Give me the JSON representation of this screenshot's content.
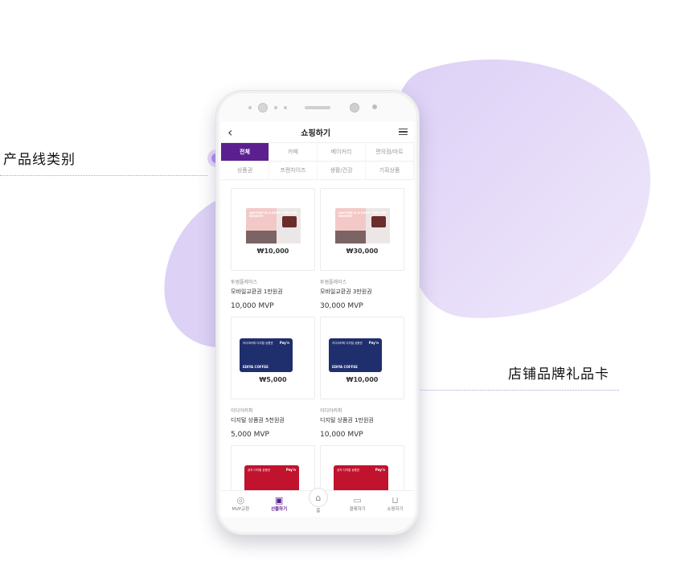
{
  "callouts": {
    "left": "产品线类别",
    "right": "店铺品牌礼品卡"
  },
  "colors": {
    "accent": "#5b1f8f",
    "blob": "#e2d8f7"
  },
  "app": {
    "back_icon": "chevron-left-icon",
    "title": "쇼핑하기",
    "menu_icon": "hamburger-icon"
  },
  "tabs_row1": [
    {
      "label": "전체",
      "active": true
    },
    {
      "label": "카페"
    },
    {
      "label": "베이커리"
    },
    {
      "label": "편의점/마트"
    }
  ],
  "tabs_row2": [
    {
      "label": "상품권"
    },
    {
      "label": "프랜차이즈"
    },
    {
      "label": "생활/건강"
    },
    {
      "label": "기획상품"
    }
  ],
  "products": [
    {
      "price_label": "₩10,000",
      "brand": "투썸플레이스",
      "name": "모바일교환권 1만원권",
      "mvp": "10,000 MVP",
      "card_text": "ANYTIME IS A GOOD TIME FOR DESSERT"
    },
    {
      "price_label": "₩30,000",
      "brand": "투썸플레이스",
      "name": "모바일교환권 3만원권",
      "mvp": "30,000 MVP",
      "card_text": "ANYTIME IS A GOOD TIME FOR DESSERT"
    },
    {
      "price_label": "₩5,000",
      "brand": "이디야커피",
      "name": "디지털 상품권 5천원권",
      "mvp": "5,000 MVP",
      "card_top": "이디야커피 디지털 상품권",
      "card_pay": "Pay'n",
      "card_brand": "EDIYA COFFEE"
    },
    {
      "price_label": "₩10,000",
      "brand": "이디야커피",
      "name": "디지털 상품권 1만원권",
      "mvp": "10,000 MVP",
      "card_top": "이디야커피 디지털 상품권",
      "card_pay": "Pay'n",
      "card_brand": "EDIYA COFFEE"
    },
    {
      "card_top": "공차 디지털 상품권",
      "card_pay": "Pay'n"
    },
    {
      "card_top": "공차 디지털 상품권",
      "card_pay": "Pay'n"
    }
  ],
  "bottom_nav": [
    {
      "label": "MVP교환",
      "icon": "exchange-icon"
    },
    {
      "label": "선물하기",
      "icon": "gift-icon",
      "active": true
    },
    {
      "label": "홈",
      "icon": "home-icon"
    },
    {
      "label": "결제하기",
      "icon": "wallet-icon"
    },
    {
      "label": "쇼핑하기",
      "icon": "cart-icon"
    }
  ]
}
